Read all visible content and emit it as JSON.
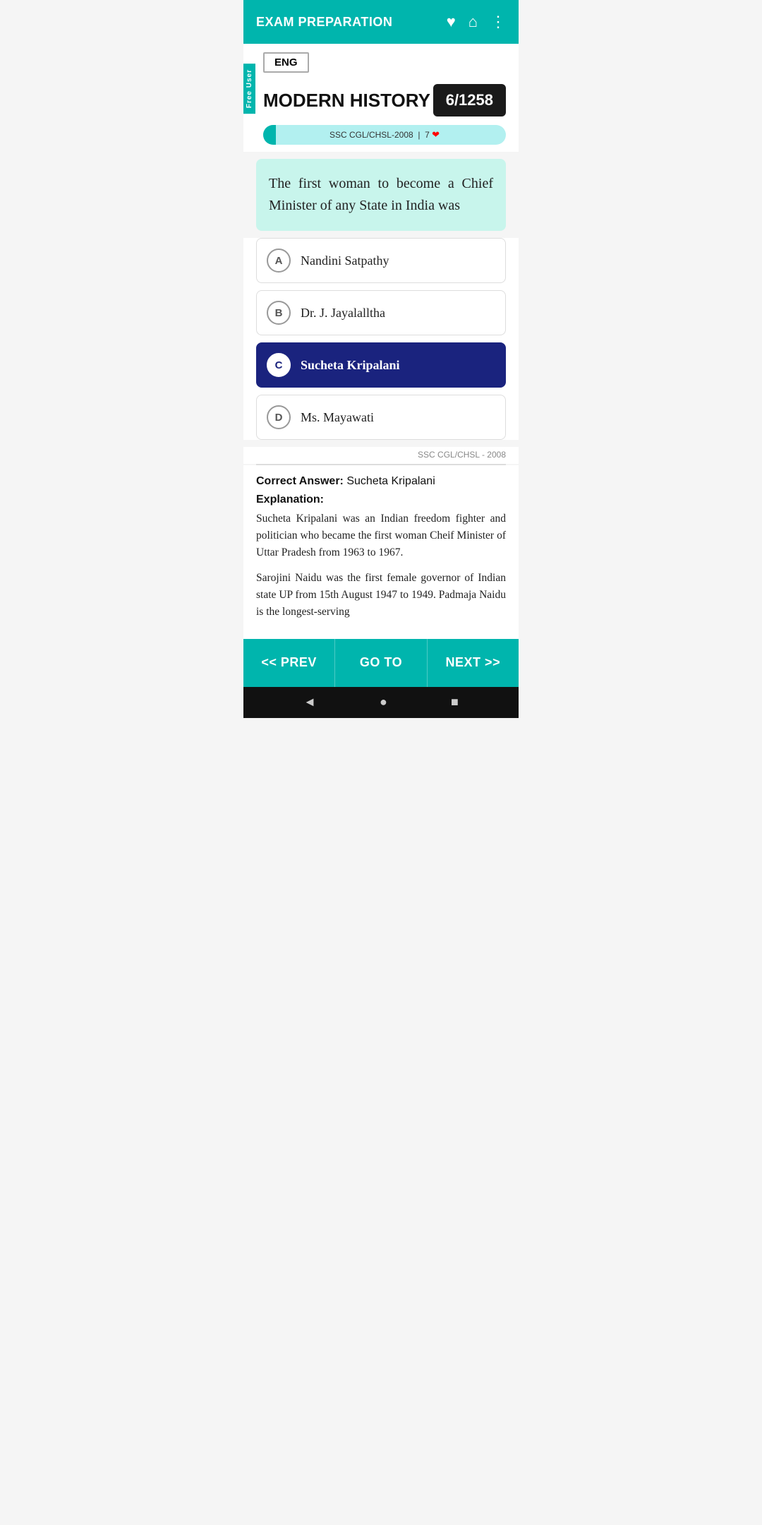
{
  "app": {
    "title": "EXAM PREPARATION",
    "icons": {
      "heart": "♥",
      "home": "⌂",
      "menu": "⋮"
    }
  },
  "free_user_badge": "Free User",
  "language": {
    "selected": "ENG"
  },
  "section": {
    "title": "MODERN HISTORY",
    "count": "6/1258"
  },
  "progress": {
    "source": "SSC CGL/CHSL-2008",
    "likes": "7"
  },
  "question": {
    "text": "The first woman to become a Chief Minister of any State in India was"
  },
  "options": [
    {
      "key": "A",
      "text": "Nandini Satpathy",
      "selected": false
    },
    {
      "key": "B",
      "text": "Dr. J. Jayalalltha",
      "selected": false
    },
    {
      "key": "C",
      "text": "Sucheta Kripalani",
      "selected": true
    },
    {
      "key": "D",
      "text": "Ms. Mayawati",
      "selected": false
    }
  ],
  "source_footer": "SSC CGL/CHSL - 2008",
  "answer": {
    "correct_label": "Correct Answer:",
    "correct_value": "Sucheta Kripalani",
    "explanation_label": "Explanation:",
    "explanation_1": "Sucheta Kripalani was an Indian freedom fighter and politician who became the first woman Cheif Minister of Uttar Pradesh from 1963 to 1967.",
    "explanation_2": "Sarojini Naidu was the first female governor of Indian state UP from 15th August 1947 to 1949. Padmaja Naidu is the longest-serving"
  },
  "navigation": {
    "prev": "<< PREV",
    "goto": "GO TO",
    "next": "NEXT >>"
  },
  "android_nav": {
    "back": "◄",
    "home": "●",
    "recents": "■"
  }
}
